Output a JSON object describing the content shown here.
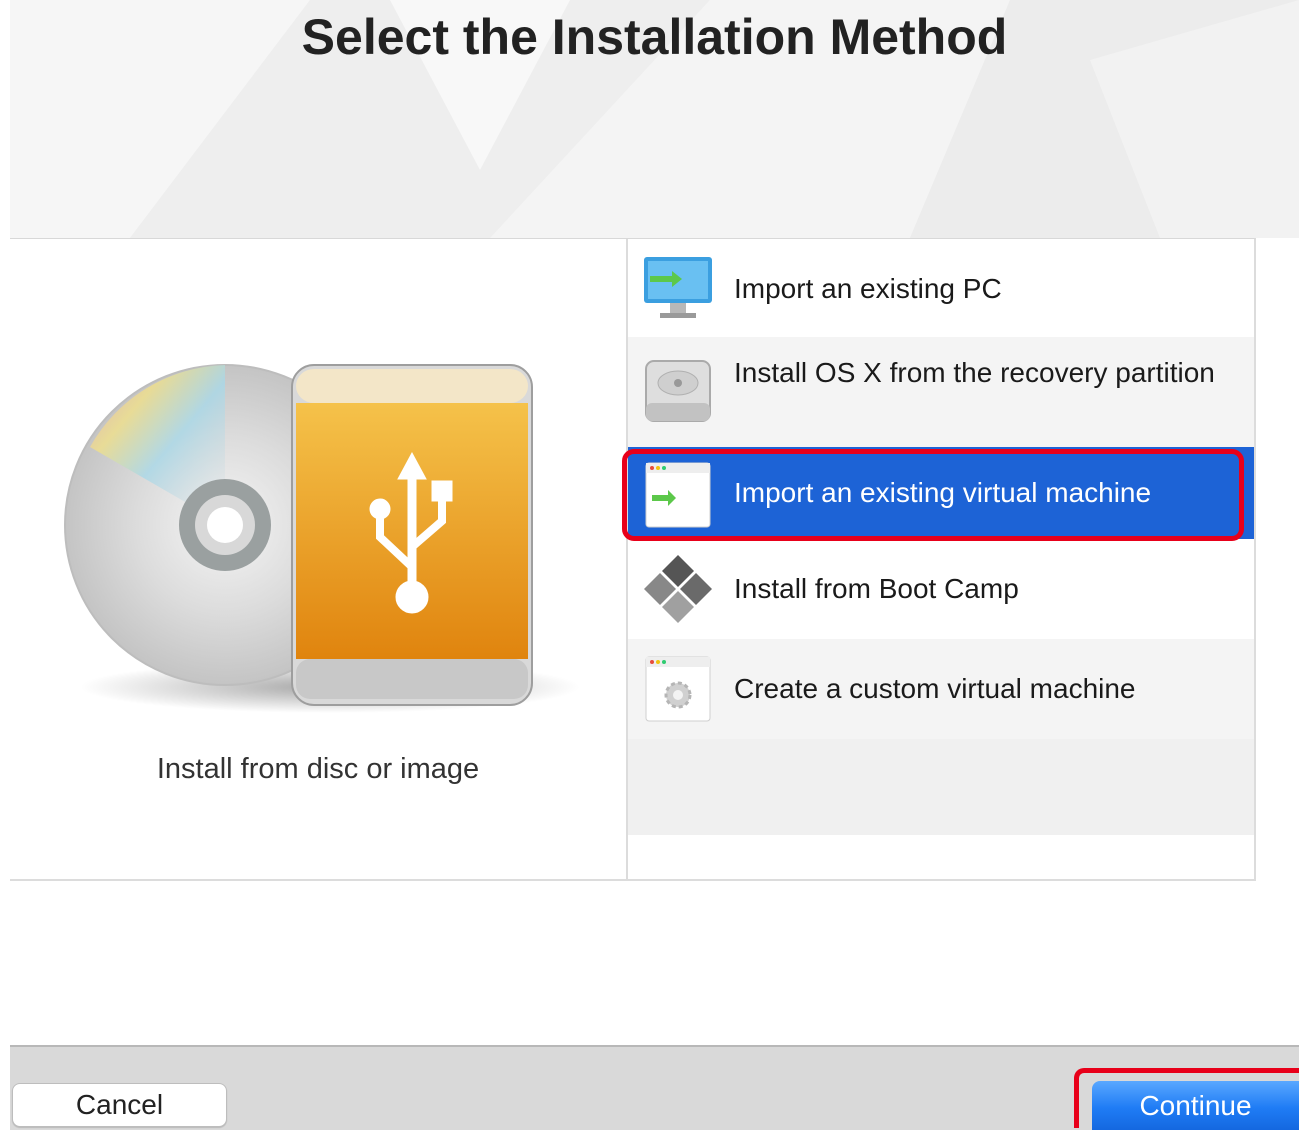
{
  "header": {
    "title": "Select the Installation Method"
  },
  "left_pane": {
    "label": "Install from disc or image"
  },
  "options": [
    {
      "label": "Import an existing PC",
      "icon": "monitor-import-icon"
    },
    {
      "label": "Install OS X from the recovery partition",
      "icon": "hard-drive-icon"
    },
    {
      "label": "Import an existing virtual machine",
      "icon": "window-import-icon",
      "selected": true
    },
    {
      "label": "Install from Boot Camp",
      "icon": "bootcamp-diamond-icon"
    },
    {
      "label": "Create a custom virtual machine",
      "icon": "window-gear-icon"
    }
  ],
  "footer": {
    "cancel_label": "Cancel",
    "continue_label": "Continue"
  },
  "colors": {
    "selection": "#1d63d6",
    "highlight": "#e8001a",
    "continue_button": "#1f7cf5"
  }
}
